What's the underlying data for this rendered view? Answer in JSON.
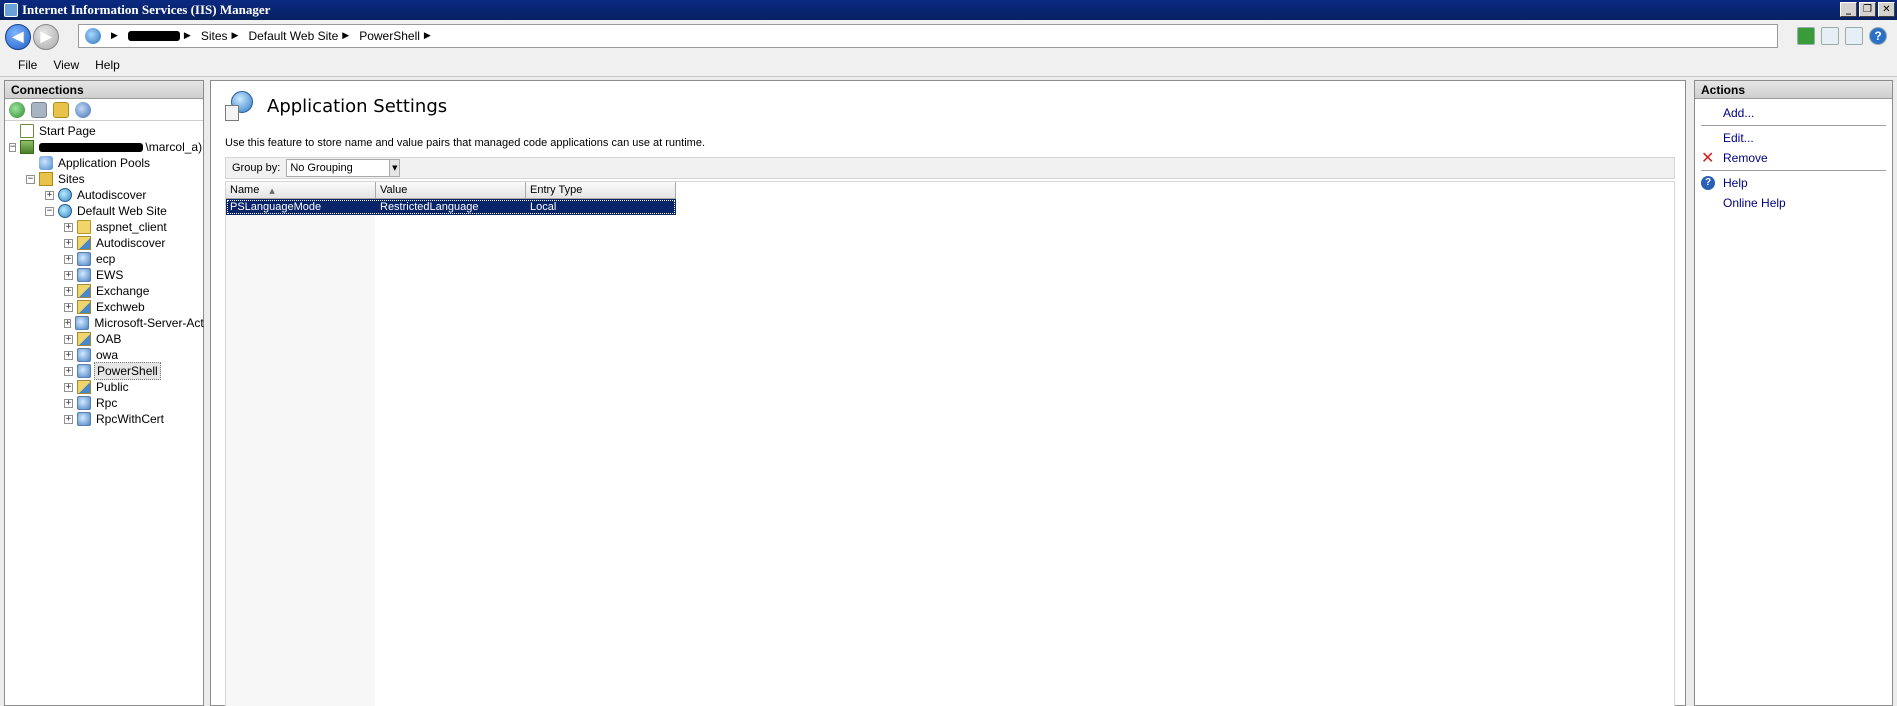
{
  "window": {
    "title": "Internet Information Services (IIS) Manager"
  },
  "address": {
    "crumbs": [
      "Sites",
      "Default Web Site",
      "PowerShell"
    ]
  },
  "menu": {
    "file": "File",
    "view": "View",
    "help": "Help"
  },
  "connections": {
    "header": "Connections",
    "tree": {
      "start_page": "Start Page",
      "server_suffix": "\\marcol_a)",
      "app_pools": "Application Pools",
      "sites": "Sites",
      "autodiscover_site": "Autodiscover",
      "default_web_site": "Default Web Site",
      "children": [
        "aspnet_client",
        "Autodiscover",
        "ecp",
        "EWS",
        "Exchange",
        "Exchweb",
        "Microsoft-Server-Act",
        "OAB",
        "owa",
        "PowerShell",
        "Public",
        "Rpc",
        "RpcWithCert"
      ]
    }
  },
  "feature": {
    "title": "Application Settings",
    "description": "Use this feature to store name and value pairs that managed code applications can use at runtime.",
    "group_by_label": "Group by:",
    "group_by_value": "No Grouping",
    "columns": {
      "name": "Name",
      "value": "Value",
      "entry_type": "Entry Type"
    },
    "rows": [
      {
        "name": "PSLanguageMode",
        "value": "RestrictedLanguage",
        "entry_type": "Local"
      }
    ]
  },
  "actions": {
    "header": "Actions",
    "add": "Add...",
    "edit": "Edit...",
    "remove": "Remove",
    "help": "Help",
    "online_help": "Online Help"
  }
}
